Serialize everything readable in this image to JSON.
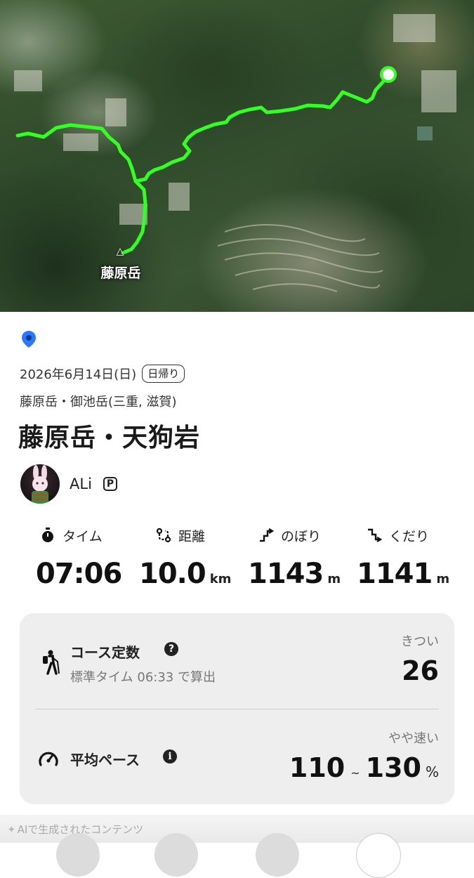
{
  "map": {
    "peak_label": "藤原岳",
    "peak_marker": "triangle-peak-marker",
    "route_color": "#33ff22",
    "endpoint_color": "#ffffff"
  },
  "record": {
    "date": "2026年6月14日(日)",
    "trip_type": "日帰り",
    "area": "藤原岳・御池岳(三重, 滋賀)",
    "title": "藤原岳・天狗岩"
  },
  "user": {
    "name": "ALi",
    "premium_badge": "P"
  },
  "stats": [
    {
      "label": "タイム",
      "value": "07:06",
      "unit": "",
      "icon": "stopwatch-icon"
    },
    {
      "label": "距離",
      "value": "10.0",
      "unit": "km",
      "icon": "route-icon"
    },
    {
      "label": "のぼり",
      "value": "1143",
      "unit": "m",
      "icon": "ascent-icon"
    },
    {
      "label": "くだり",
      "value": "1141",
      "unit": "m",
      "icon": "descent-icon"
    }
  ],
  "course": {
    "title": "コース定数",
    "standard_time": "標準タイム 06:33 で算出",
    "difficulty": "きつい",
    "value": "26"
  },
  "pace": {
    "title": "平均ペース",
    "speed": "やや速い",
    "min": "110",
    "tilde": "~",
    "max": "130",
    "unit": "%"
  },
  "footer": {
    "ai_note": "AIで生成されたコンテンツ"
  },
  "colors": {
    "card_bg": "#eeeeee",
    "pin_blue": "#2979ff"
  }
}
